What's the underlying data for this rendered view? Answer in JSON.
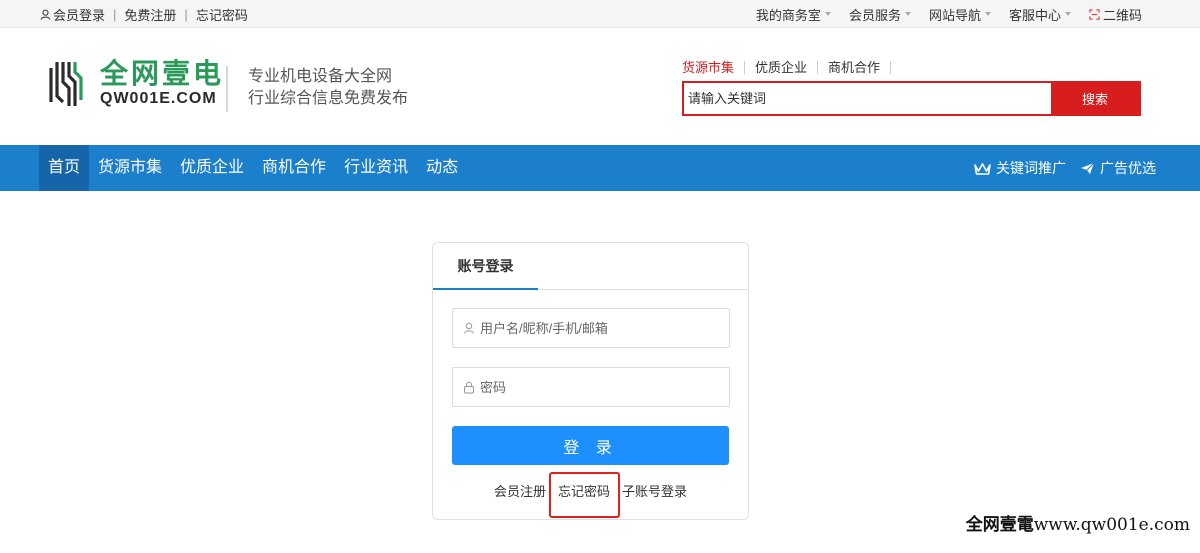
{
  "topbar": {
    "left": [
      "会员登录",
      "免费注册",
      "忘记密码"
    ],
    "right": [
      {
        "label": "我的商务室",
        "caret": true
      },
      {
        "label": "会员服务",
        "caret": true
      },
      {
        "label": "网站导航",
        "caret": true
      },
      {
        "label": "客服中心",
        "caret": true
      },
      {
        "label": "二维码",
        "caret": false
      }
    ]
  },
  "logo": {
    "cn": "全网壹电",
    "en": "QW001E.COM"
  },
  "slogan": {
    "line1": "专业机电设备大全网",
    "line2": "行业综合信息免费发布"
  },
  "search": {
    "tabs": [
      "货源市集",
      "优质企业",
      "商机合作"
    ],
    "active_tab": 0,
    "placeholder": "请输入关键词",
    "button": "搜索"
  },
  "nav": {
    "items": [
      "首页",
      "货源市集",
      "优质企业",
      "商机合作",
      "行业资讯",
      "动态"
    ],
    "active": 0,
    "right": [
      "关键词推广",
      "广告优选"
    ]
  },
  "login": {
    "tab": "账号登录",
    "username_placeholder": "用户名/昵称/手机/邮箱",
    "password_placeholder": "密码",
    "submit": "登 录",
    "links": [
      "会员注册",
      "忘记密码",
      "子账号登录"
    ]
  },
  "watermark": {
    "brand": "全网壹電",
    "url": "www.qw001e.com"
  },
  "colors": {
    "brand_red": "#d71d1d",
    "nav_blue": "#1b7fcc",
    "button_blue": "#1e8fff",
    "logo_green": "#2a9a5a"
  }
}
